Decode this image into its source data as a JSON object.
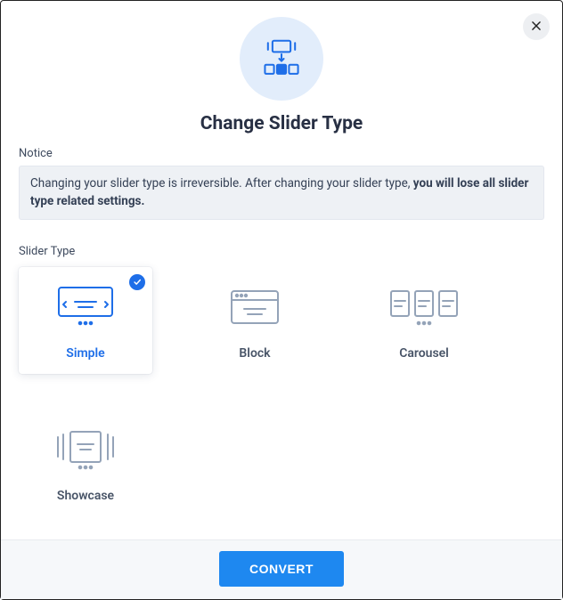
{
  "title": "Change Slider Type",
  "notice": {
    "label": "Notice",
    "text_normal": "Changing your slider type is irreversible. After changing your slider type, ",
    "text_bold": "you will lose all slider type related settings."
  },
  "slider_type": {
    "label": "Slider Type",
    "options": [
      {
        "id": "simple",
        "label": "Simple",
        "selected": true
      },
      {
        "id": "block",
        "label": "Block",
        "selected": false
      },
      {
        "id": "carousel",
        "label": "Carousel",
        "selected": false
      },
      {
        "id": "showcase",
        "label": "Showcase",
        "selected": false
      }
    ]
  },
  "footer": {
    "convert_label": "CONVERT"
  }
}
